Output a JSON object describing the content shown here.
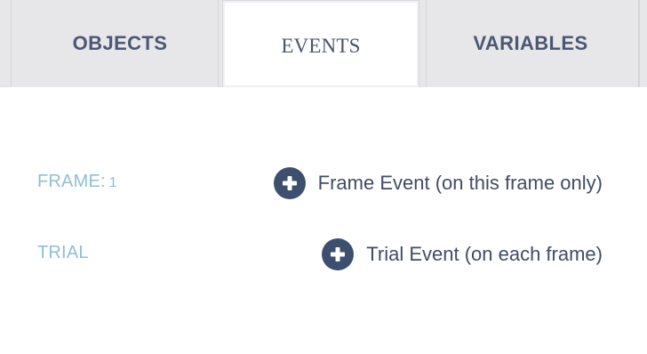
{
  "tabs": {
    "objects": {
      "label": "OBJECTS"
    },
    "events": {
      "label": "EVENTS"
    },
    "variables": {
      "label": "VARIABLES"
    }
  },
  "events_panel": {
    "frame_row": {
      "label": "FRAME:",
      "frame_number": "1",
      "add_label": "Frame Event (on this frame only)",
      "icon": "plus-circle-icon"
    },
    "trial_row": {
      "label": "TRIAL",
      "add_label": "Trial Event (on each frame)",
      "icon": "plus-circle-icon"
    }
  },
  "colors": {
    "tab_background": "#e7e7ea",
    "tab_text": "#4b5773",
    "active_tab_background": "#ffffff",
    "row_label": "#8fbfd3",
    "plus_circle": "#3d4f6e",
    "action_text": "#424c64"
  }
}
